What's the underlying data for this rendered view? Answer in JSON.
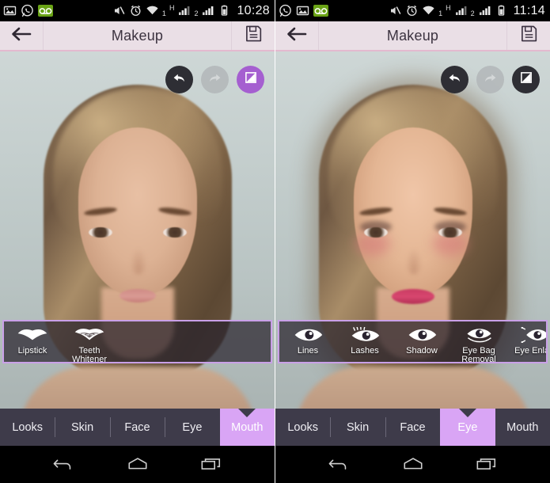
{
  "panels": [
    {
      "id": "before",
      "status": {
        "icons": [
          "image-icon",
          "whatsapp-icon",
          "voicemail-icon"
        ],
        "right_icons": [
          "mute-icon",
          "alarm-icon",
          "wifi-icon"
        ],
        "sim1_label": "1",
        "network_label": "H",
        "sim2_label": "2",
        "battery_icon": "battery-icon",
        "clock": "10:28"
      },
      "titlebar": {
        "back_icon": "back-arrow-icon",
        "title": "Makeup",
        "save_icon": "save-floppy-icon"
      },
      "actions": {
        "undo_icon": "undo-arrow-icon",
        "redo_icon": "redo-arrow-icon",
        "compare_icon": "compare-split-icon",
        "undo_enabled": true,
        "redo_enabled": false,
        "compare_active": true
      },
      "toolstrip": [
        {
          "icon": "lips-icon",
          "label": "Lipstick"
        },
        {
          "icon": "lips-teeth-icon",
          "label": "Teeth\nWhitener"
        }
      ],
      "tabs": [
        {
          "label": "Looks",
          "active": false
        },
        {
          "label": "Skin",
          "active": false
        },
        {
          "label": "Face",
          "active": false
        },
        {
          "label": "Eye",
          "active": false
        },
        {
          "label": "Mouth",
          "active": true
        }
      ],
      "nav": [
        "nav-back-icon",
        "nav-home-icon",
        "nav-recents-icon"
      ]
    },
    {
      "id": "after",
      "status": {
        "icons": [
          "whatsapp-icon",
          "image-icon",
          "voicemail-icon"
        ],
        "right_icons": [
          "mute-icon",
          "alarm-icon",
          "wifi-icon"
        ],
        "sim1_label": "1",
        "network_label": "H",
        "sim2_label": "2",
        "battery_icon": "battery-icon",
        "clock": "11:14"
      },
      "titlebar": {
        "back_icon": "back-arrow-icon",
        "title": "Makeup",
        "save_icon": "save-floppy-icon"
      },
      "actions": {
        "undo_icon": "undo-arrow-icon",
        "redo_icon": "redo-arrow-icon",
        "compare_icon": "compare-split-icon",
        "undo_enabled": true,
        "redo_enabled": false,
        "compare_active": false
      },
      "toolstrip": [
        {
          "icon": "eye-icon",
          "label": "Lines"
        },
        {
          "icon": "eye-lashes-icon",
          "label": "Lashes"
        },
        {
          "icon": "eye-shadow-icon",
          "label": "Shadow"
        },
        {
          "icon": "eye-bag-icon",
          "label": "Eye Bag\nRemoval"
        },
        {
          "icon": "eye-enlarge-icon",
          "label": "Eye Enlarg"
        }
      ],
      "tabs": [
        {
          "label": "Looks",
          "active": false
        },
        {
          "label": "Skin",
          "active": false
        },
        {
          "label": "Face",
          "active": false
        },
        {
          "label": "Eye",
          "active": true
        },
        {
          "label": "Mouth",
          "active": false
        }
      ],
      "nav": [
        "nav-back-icon",
        "nav-home-icon",
        "nav-recents-icon"
      ]
    }
  ],
  "colors": {
    "titlebar_bg": "#eadfe6",
    "titlebar_rule": "#e3b9cf",
    "tabbar_bg": "#3e3b4a",
    "tab_active_bg": "#d9a5f5",
    "accent_purple": "#a55fd0",
    "strip_border": "#c9a0e8",
    "voicemail_green": "#6aa316"
  }
}
